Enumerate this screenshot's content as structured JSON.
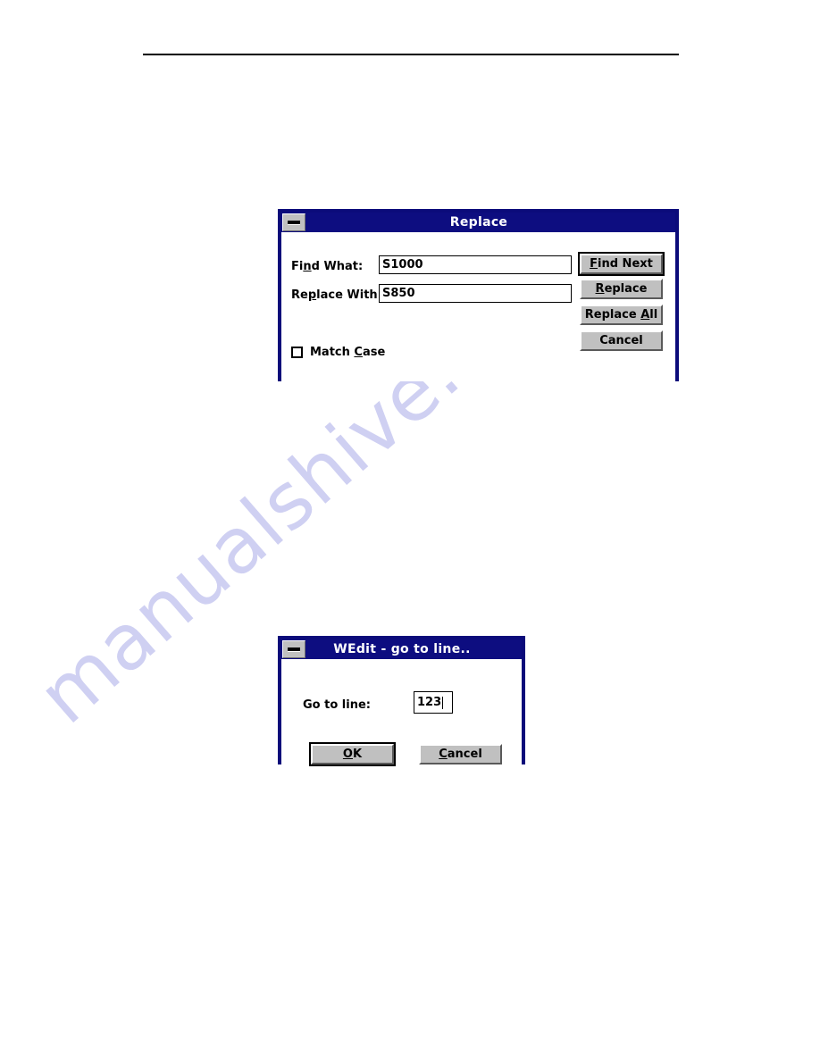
{
  "page": {
    "background_color": "#ffffff",
    "rule_color": "#000000",
    "watermark": {
      "text": "manualshive.com",
      "color": "#cfd0f2"
    }
  },
  "dialogs": [
    {
      "id": "replace",
      "title": "Replace",
      "titlebar_color": "#0d0d80",
      "frame_color": "#0b0b7a",
      "minimize_icon": "minimize-icon",
      "fields": [
        {
          "label_pre": "Fi",
          "label_accel": "n",
          "label_post": "d What:",
          "label_full": "Find What:",
          "value": "S1000",
          "placeholder": ""
        },
        {
          "label_pre": "Re",
          "label_accel": "p",
          "label_post": "lace With:",
          "label_full": "Replace With:",
          "value": "S850",
          "placeholder": ""
        }
      ],
      "buttons": [
        {
          "pre": "",
          "accel": "F",
          "post": "ind Next",
          "full": "Find Next",
          "default": true
        },
        {
          "pre": "",
          "accel": "R",
          "post": "eplace",
          "full": "Replace",
          "default": false
        },
        {
          "pre": "Replace ",
          "accel": "A",
          "post": "ll",
          "full": "Replace All",
          "default": false
        },
        {
          "pre": "Cancel",
          "accel": "",
          "post": "",
          "full": "Cancel",
          "default": false
        }
      ],
      "checkbox": {
        "pre": "Match ",
        "accel": "C",
        "post": "ase",
        "full": "Match Case",
        "checked": false
      }
    },
    {
      "id": "goto",
      "title": "WEdit - go to line..",
      "titlebar_color": "#0d0d80",
      "frame_color": "#0b0b7a",
      "minimize_icon": "minimize-icon",
      "fields": [
        {
          "label_pre": "Go to line:",
          "label_accel": "",
          "label_post": "",
          "label_full": "Go to line:",
          "value": "123",
          "placeholder": ""
        }
      ],
      "buttons": [
        {
          "pre": "",
          "accel": "O",
          "post": "K",
          "full": "OK",
          "default": true
        },
        {
          "pre": "",
          "accel": "C",
          "post": "ancel",
          "full": "Cancel",
          "default": false
        }
      ]
    }
  ]
}
